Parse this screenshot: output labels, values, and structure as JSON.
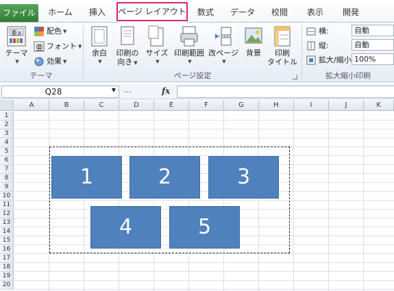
{
  "tabs": [
    "ファイル",
    "ホーム",
    "挿入",
    "ページ レイアウト",
    "数式",
    "データ",
    "校閲",
    "表示",
    "開発"
  ],
  "active_tab": "ページ レイアウト",
  "theme_group": {
    "label": "テーマ",
    "theme_button": "テーマ",
    "colors": "配色",
    "fonts": "フォント",
    "effects": "効果"
  },
  "page_setup_group": {
    "label": "ページ設定",
    "margins": "余白",
    "orientation_line1": "印刷の",
    "orientation_line2": "向き",
    "size": "サイズ",
    "print_area": "印刷範囲",
    "breaks": "改ページ",
    "background": "背景",
    "print_titles_line1": "印刷",
    "print_titles_line2": "タイトル"
  },
  "scale_group": {
    "label": "拡大縮小印刷",
    "width_label": "横:",
    "width_value": "自動",
    "height_label": "縦:",
    "height_value": "自動",
    "scale_label": "拡大/縮小:",
    "scale_value": "100%"
  },
  "formula_bar": {
    "name_box": "Q28",
    "fx": "fx",
    "formula": ""
  },
  "columns": [
    "A",
    "B",
    "C",
    "D",
    "E",
    "F",
    "G",
    "H",
    "I",
    "J",
    "K"
  ],
  "rows": [
    "1",
    "2",
    "3",
    "4",
    "5",
    "6",
    "7",
    "8",
    "9",
    "10",
    "11",
    "12",
    "13",
    "14",
    "15",
    "16",
    "17",
    "18",
    "19",
    "20"
  ],
  "shapes": [
    "1",
    "2",
    "3",
    "4",
    "5"
  ],
  "colors": {
    "file_tab": "#3a8a3e",
    "highlight": "#d9236b",
    "shape_fill": "#4f81bd"
  }
}
